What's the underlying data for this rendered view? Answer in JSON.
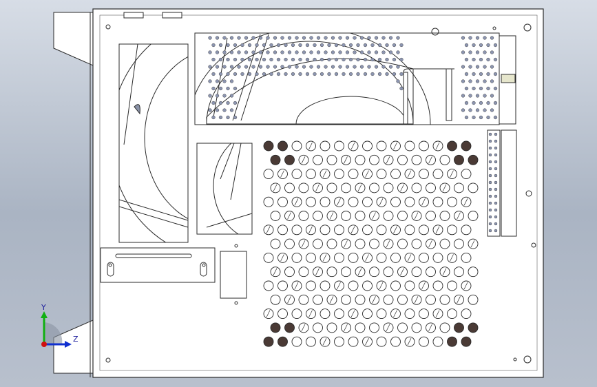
{
  "viewport": {
    "background_top": "#d7dde6",
    "background_bottom": "#aab4c3",
    "line_color": "#2a2a2a",
    "panel_fill": "#ffffff",
    "accent_fill": "#e6e6cc"
  },
  "triad": {
    "x_axis_color": "#d01010",
    "y_axis_color": "#10b010",
    "z_axis_color": "#1030d0",
    "y_label": "Y",
    "z_label": "Z"
  }
}
